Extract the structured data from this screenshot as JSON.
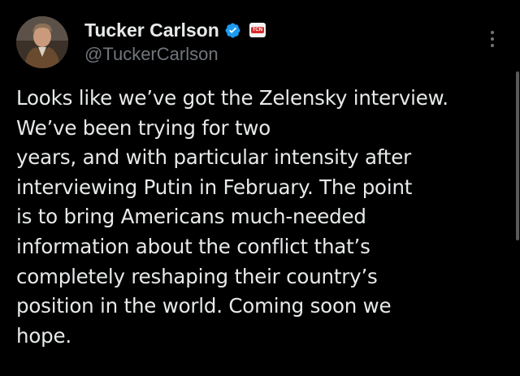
{
  "author": {
    "display_name": "Tucker Carlson",
    "handle": "@TuckerCarlson",
    "avatar_icon": "person-avatar",
    "verified_icon": "verified-badge-icon",
    "verified_color": "#1d9bf0",
    "affiliate_badge_text": "TCN",
    "affiliate_badge_color": "#d62b2b"
  },
  "tweet": {
    "text": "Looks like we’ve got the Zelensky interview. We’ve been trying for two\nyears, and with particular intensity after\ninterviewing Putin in February. The point\nis to bring Americans much-needed\ninformation about the conflict that’s\ncompletely reshaping their country’s\nposition in the world. Coming soon we\nhope."
  },
  "menu": {
    "more_icon": "more-options-icon"
  },
  "colors": {
    "background": "#000000",
    "text_primary": "#e7e9ea",
    "text_secondary": "#71767b"
  }
}
